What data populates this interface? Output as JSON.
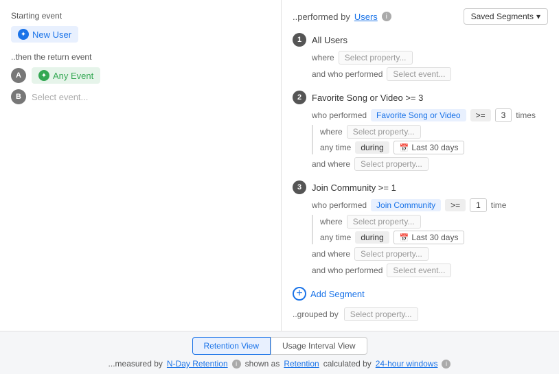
{
  "left": {
    "starting_label": "Starting event",
    "new_user_label": "New User",
    "then_label": "..then the return event",
    "event_a_label": "Any Event",
    "event_b_placeholder": "Select event...",
    "event_a_letter": "A",
    "event_b_letter": "B"
  },
  "right": {
    "performed_by_prefix": "..performed by",
    "users_label": "Users",
    "saved_segments_label": "Saved Segments",
    "segments": [
      {
        "number": "1",
        "title": "All Users",
        "where_label": "where",
        "where_select": "Select property...",
        "and_who_performed_label": "and who performed",
        "and_who_performed_select": "Select event..."
      },
      {
        "number": "2",
        "title": "Favorite Song or Video >= 3",
        "who_performed_label": "who performed",
        "event_chip": "Favorite Song or Video",
        "operator": ">=",
        "count": "3",
        "times_label": "times",
        "where_label": "where",
        "where_select": "Select property...",
        "any_time_label": "any time",
        "during_label": "during",
        "date_label": "Last 30 days",
        "and_where_label": "and where",
        "and_where_select": "Select property..."
      },
      {
        "number": "3",
        "title": "Join Community >= 1",
        "who_performed_label": "who performed",
        "event_chip": "Join Community",
        "operator": ">=",
        "count": "1",
        "time_label": "time",
        "where_label": "where",
        "where_select": "Select property...",
        "any_time_label": "any time",
        "during_label": "during",
        "date_label": "Last 30 days",
        "and_where_label": "and where",
        "and_where_select": "Select property...",
        "and_who_performed_label": "and who performed",
        "and_who_performed_select": "Select event..."
      }
    ],
    "add_segment_label": "Add Segment",
    "grouped_by_label": "..grouped by",
    "grouped_by_select": "Select property..."
  },
  "bottom": {
    "retention_view_label": "Retention View",
    "usage_interval_view_label": "Usage Interval View",
    "measured_prefix": "...measured by",
    "n_day_retention_label": "N-Day Retention",
    "shown_as_prefix": "shown as",
    "retention_label": "Retention",
    "calculated_by_prefix": "calculated by",
    "windows_label": "24-hour windows"
  }
}
